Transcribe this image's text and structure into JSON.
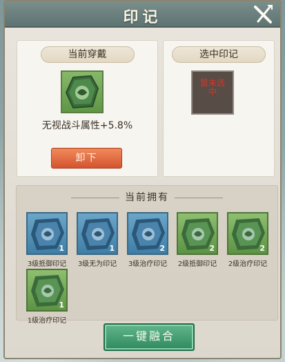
{
  "title": "印记",
  "close": {
    "icon": "close-x-icon"
  },
  "equipped": {
    "header": "当前穿戴",
    "gem_icon": "mark-gem-icon",
    "description": "无视战斗属性+5.8%",
    "remove_label": "卸下"
  },
  "selected": {
    "header": "选中印记",
    "empty_text": "暂未选中"
  },
  "owned": {
    "title": "当前拥有",
    "items": [
      {
        "label": "3级抵御印记",
        "count": "1",
        "color": "blue"
      },
      {
        "label": "3级无为印记",
        "count": "1",
        "color": "blue"
      },
      {
        "label": "3级治疗印记",
        "count": "2",
        "color": "blue"
      },
      {
        "label": "2级抵御印记",
        "count": "2",
        "color": "green"
      },
      {
        "label": "2级治疗印记",
        "count": "2",
        "color": "green"
      },
      {
        "label": "1级治疗印记",
        "count": "1",
        "color": "green"
      }
    ]
  },
  "fuse_label": "一键融合",
  "colors": {
    "accent_red": "#d5532f",
    "accent_green": "#2f8a5f",
    "blue_gem": "#3f7fa6",
    "green_gem": "#5c9444"
  }
}
